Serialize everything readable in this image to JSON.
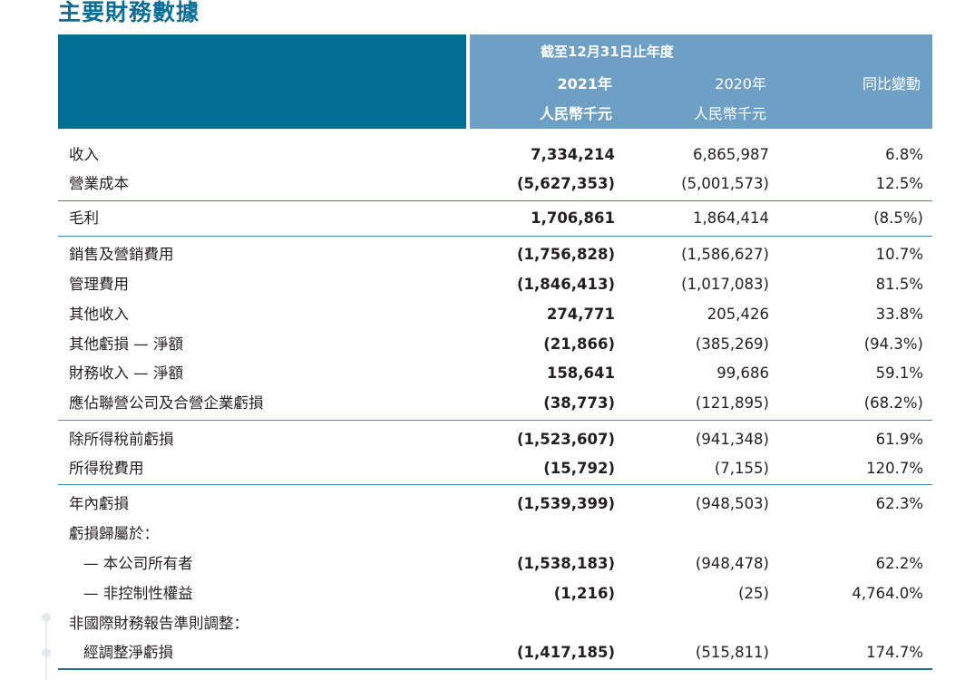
{
  "title": "主要財務數據",
  "header": {
    "period": "截至12月31日止年度",
    "col1_year": "2021年",
    "col2_year": "2020年",
    "col3": "同比變動",
    "col1_unit": "人民幣千元",
    "col2_unit": "人民幣千元"
  },
  "rows": [
    {
      "label": "收入",
      "v2021": "7,334,214",
      "v2020": "6,865,987",
      "change": "6.8%"
    },
    {
      "label": "營業成本",
      "v2021": "(5,627,353)",
      "v2020": "(5,001,573)",
      "change": "12.5%"
    },
    {
      "label": "毛利",
      "v2021": "1,706,861",
      "v2020": "1,864,414",
      "change": "(8.5%)"
    },
    {
      "label": "銷售及營銷費用",
      "v2021": "(1,756,828)",
      "v2020": "(1,586,627)",
      "change": "10.7%"
    },
    {
      "label": "管理費用",
      "v2021": "(1,846,413)",
      "v2020": "(1,017,083)",
      "change": "81.5%"
    },
    {
      "label": "其他收入",
      "v2021": "274,771",
      "v2020": "205,426",
      "change": "33.8%"
    },
    {
      "label": "其他虧損 — 淨額",
      "v2021": "(21,866)",
      "v2020": "(385,269)",
      "change": "(94.3%)"
    },
    {
      "label": "財務收入 — 淨額",
      "v2021": "158,641",
      "v2020": "99,686",
      "change": "59.1%"
    },
    {
      "label": "應佔聯營公司及合營企業虧損",
      "v2021": "(38,773)",
      "v2020": "(121,895)",
      "change": "(68.2%)"
    },
    {
      "label": "除所得稅前虧損",
      "v2021": "(1,523,607)",
      "v2020": "(941,348)",
      "change": "61.9%"
    },
    {
      "label": "所得稅費用",
      "v2021": "(15,792)",
      "v2020": "(7,155)",
      "change": "120.7%"
    },
    {
      "label": "年內虧損",
      "v2021": "(1,539,399)",
      "v2020": "(948,503)",
      "change": "62.3%"
    },
    {
      "label": "虧損歸屬於：",
      "v2021": "",
      "v2020": "",
      "change": ""
    },
    {
      "label": "— 本公司所有者",
      "v2021": "(1,538,183)",
      "v2020": "(948,478)",
      "change": "62.2%"
    },
    {
      "label": "— 非控制性權益",
      "v2021": "(1,216)",
      "v2020": "(25)",
      "change": "4,764.0%"
    },
    {
      "label": "非國際財務報告準則調整：",
      "v2021": "",
      "v2020": "",
      "change": ""
    },
    {
      "label": "經調整淨虧損",
      "v2021": "(1,417,185)",
      "v2020": "(515,811)",
      "change": "174.7%"
    }
  ]
}
